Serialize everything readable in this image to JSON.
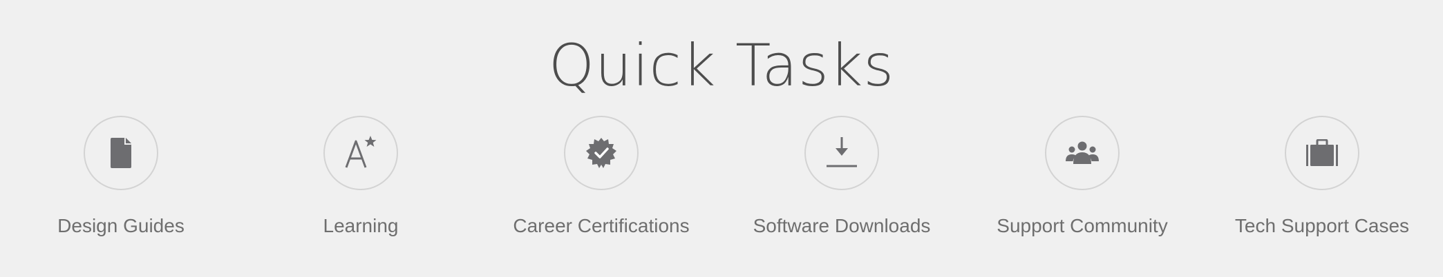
{
  "section": {
    "title": "Quick Tasks"
  },
  "tasks": [
    {
      "label": "Design Guides",
      "icon": "document-icon"
    },
    {
      "label": "Learning",
      "icon": "learning-icon"
    },
    {
      "label": "Career Certifications",
      "icon": "certification-badge-icon"
    },
    {
      "label": "Software Downloads",
      "icon": "download-icon"
    },
    {
      "label": "Support Community",
      "icon": "community-icon"
    },
    {
      "label": "Tech Support Cases",
      "icon": "briefcase-icon"
    }
  ],
  "colors": {
    "background": "#f0f0f0",
    "title": "#4d4d4d",
    "label": "#6e6e6e",
    "icon": "#6d6d70",
    "circle_border": "#d3d3d3"
  }
}
